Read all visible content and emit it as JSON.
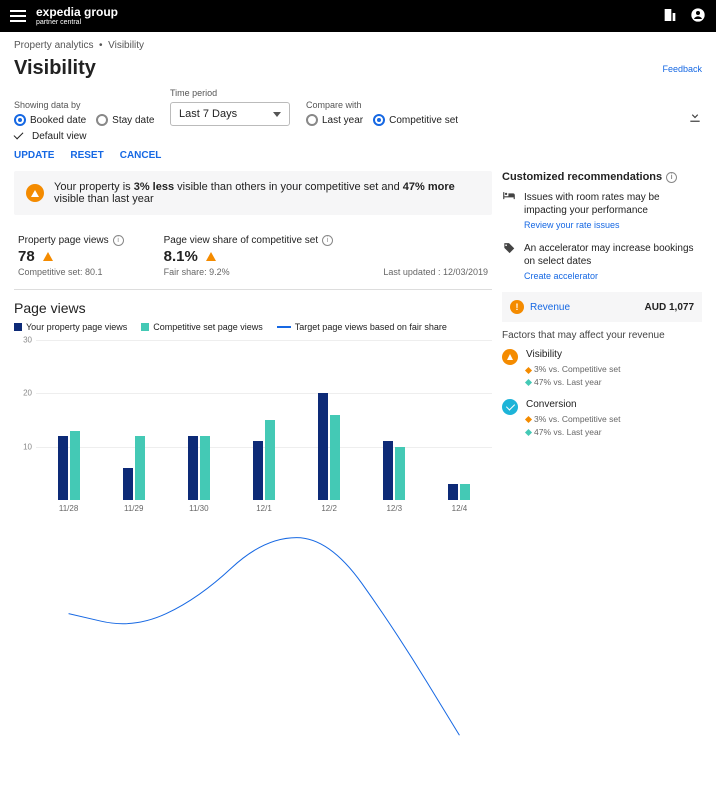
{
  "header": {
    "brand_main": "expedia group",
    "brand_sub": "partner central"
  },
  "breadcrumb": {
    "parent": "Property analytics",
    "current": "Visibility"
  },
  "page": {
    "title": "Visibility",
    "feedback": "Feedback"
  },
  "filters": {
    "showing_label": "Showing data by",
    "radio_booked": "Booked date",
    "radio_stay": "Stay date",
    "time_label": "Time period",
    "time_value": "Last 7 Days",
    "compare_label": "Compare with",
    "radio_last_year": "Last year",
    "radio_comp_set": "Competitive set",
    "default_view": "Default view"
  },
  "actions": {
    "update": "UPDATE",
    "reset": "RESET",
    "cancel": "CANCEL"
  },
  "banner": {
    "prefix": "Your property is ",
    "pct1": "3% less",
    "mid": " visible than others in your competitive set and ",
    "pct2": "47% more",
    "suffix": " visible than last year"
  },
  "metrics": {
    "m1_label": "Property page views",
    "m1_value": "78",
    "m1_sub": "Competitive set: 80.1",
    "m2_label": "Page view share of competitive set",
    "m2_value": "8.1%",
    "m2_sub": "Fair share: 9.2%",
    "last_updated": "Last updated : 12/03/2019"
  },
  "chart_section": {
    "title": "Page views",
    "legend_your": "Your property page views",
    "legend_comp": "Competitive set page views",
    "legend_target": "Target page views based on fair share"
  },
  "chart_data": {
    "type": "bar",
    "categories": [
      "11/28",
      "11/29",
      "11/30",
      "12/1",
      "12/2",
      "12/3",
      "12/4"
    ],
    "series": [
      {
        "name": "Your property page views",
        "values": [
          12,
          6,
          12,
          11,
          20,
          11,
          3
        ]
      },
      {
        "name": "Competitive set page views",
        "values": [
          13,
          12,
          12,
          15,
          16,
          10,
          3
        ]
      }
    ],
    "target_line": [
      12,
      11,
      13,
      17,
      17,
      11,
      4
    ],
    "ylim": [
      0,
      30
    ],
    "yticks": [
      10,
      20,
      30
    ]
  },
  "recommendations": {
    "title": "Customized recommendations",
    "r1_text": "Issues with room rates may be impacting your performance",
    "r1_link": "Review your rate issues",
    "r2_text": "An accelerator may increase bookings on select dates",
    "r2_link": "Create accelerator"
  },
  "revenue": {
    "label": "Revenue",
    "amount": "AUD 1,077"
  },
  "factors": {
    "title": "Factors that may affect your revenue",
    "f1_name": "Visibility",
    "f1_p1": "3% vs. Competitive set",
    "f1_p2": "47% vs. Last year",
    "f2_name": "Conversion",
    "f2_p1": "3% vs. Competitive set",
    "f2_p2": "47% vs. Last year"
  }
}
